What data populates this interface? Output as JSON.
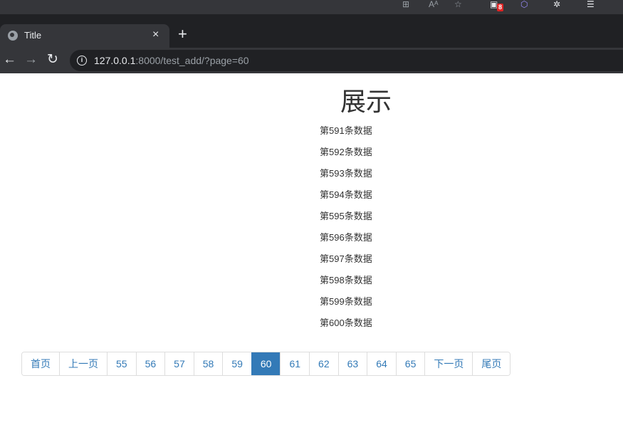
{
  "browser": {
    "tab_title": "Title",
    "tab_close": "×",
    "new_tab": "+",
    "url_host": "127.0.0.1",
    "url_rest": ":8000/test_add/?page=60",
    "extension_badge": "8",
    "colors": {
      "chrome_dark": "#202124",
      "chrome_mid": "#35363a",
      "text": "#e8eaed",
      "muted": "#9aa0a6"
    }
  },
  "page": {
    "title": "展示",
    "items": [
      "第591条数据",
      "第592条数据",
      "第593条数据",
      "第594条数据",
      "第595条数据",
      "第596条数据",
      "第597条数据",
      "第598条数据",
      "第599条数据",
      "第600条数据"
    ]
  },
  "pagination": {
    "first": "首页",
    "prev": "上一页",
    "pages": [
      "55",
      "56",
      "57",
      "58",
      "59",
      "60",
      "61",
      "62",
      "63",
      "64",
      "65"
    ],
    "active": "60",
    "next": "下一页",
    "last": "尾页",
    "colors": {
      "link": "#337ab7",
      "active_bg": "#337ab7",
      "border": "#dddddd"
    }
  }
}
